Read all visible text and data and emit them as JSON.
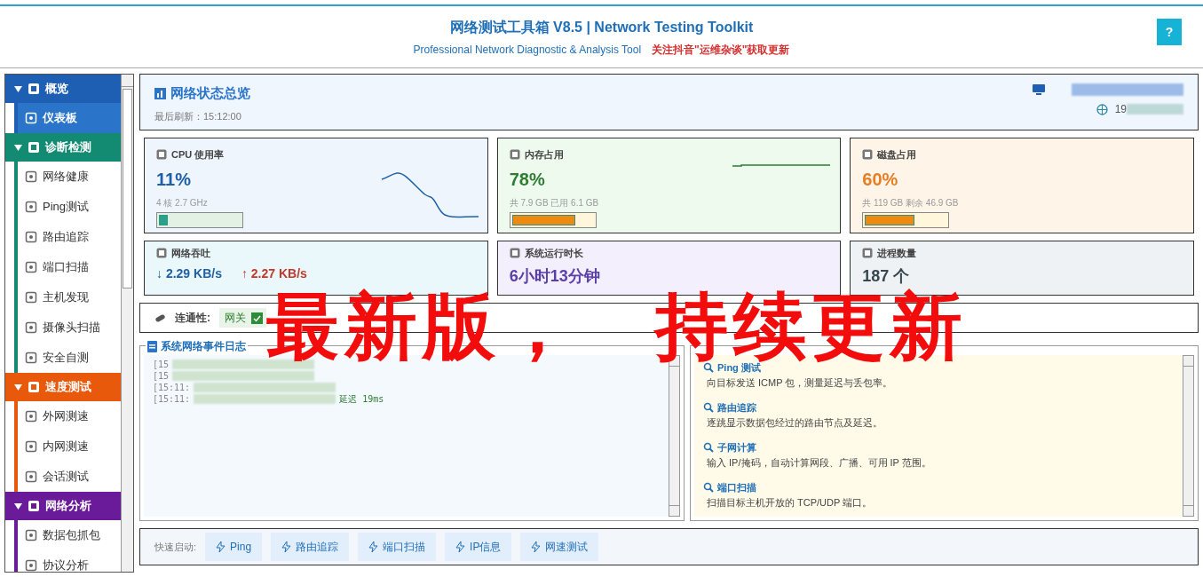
{
  "header": {
    "title": "网络测试工具箱 V8.5 | Network Testing Toolkit",
    "subtitle": "Professional Network Diagnostic & Analysis Tool",
    "promo": "关注抖音\"运维杂谈\"获取更新",
    "help_button": "?"
  },
  "sidebar": {
    "groups": [
      {
        "label": "概览",
        "color": "#1e5fb4",
        "expanded": true,
        "items": [
          {
            "label": "仪表板",
            "selected": true
          }
        ]
      },
      {
        "label": "诊断检测",
        "color": "#138a72",
        "expanded": true,
        "items": [
          {
            "label": "网络健康",
            "selected": false
          },
          {
            "label": "Ping测试",
            "selected": false
          },
          {
            "label": "路由追踪",
            "selected": false
          },
          {
            "label": "端口扫描",
            "selected": false
          },
          {
            "label": "主机发现",
            "selected": false
          },
          {
            "label": "摄像头扫描",
            "selected": false
          },
          {
            "label": "安全自测",
            "selected": false
          }
        ]
      },
      {
        "label": "速度测试",
        "color": "#e8590c",
        "expanded": true,
        "items": [
          {
            "label": "外网测速",
            "selected": false
          },
          {
            "label": "内网测速",
            "selected": false
          },
          {
            "label": "会话测试",
            "selected": false
          }
        ]
      },
      {
        "label": "网络分析",
        "color": "#6a1b9a",
        "expanded": true,
        "items": [
          {
            "label": "数据包抓包",
            "selected": false
          },
          {
            "label": "协议分析",
            "selected": false
          }
        ]
      }
    ]
  },
  "overview": {
    "title": "网络状态总览",
    "refreshed": "最后刷新：15:12:00",
    "ip_prefix": "19"
  },
  "cards": [
    {
      "kind": "meter",
      "title": "CPU 使用率",
      "value": "11%",
      "detail": "4 核  2.7 GHz",
      "level": 0.11,
      "color": "#1e5fa8"
    },
    {
      "kind": "meter",
      "title": "内存占用",
      "value": "78%",
      "detail": "共 7.9 GB  已用 6.1 GB",
      "level": 0.78,
      "color": "#2e7d32"
    },
    {
      "kind": "meter",
      "title": "磁盘占用",
      "value": "60%",
      "detail": "共 119 GB  剩余 46.9 GB",
      "level": 0.6,
      "color": "#e67e22"
    },
    {
      "kind": "throughput",
      "title": "网络吞吐",
      "down": "↓ 2.29 KB/s",
      "up": "↑ 2.27 KB/s",
      "color": "#1e5fa8"
    },
    {
      "kind": "plain",
      "title": "系统运行时长",
      "value": "6小时13分钟",
      "color": "#5b3fa8"
    },
    {
      "kind": "plain",
      "title": "进程数量",
      "value": "187 个",
      "color": "#37474f"
    }
  ],
  "connectivity": {
    "label": "连通性:",
    "checks": [
      {
        "label": "网关",
        "ok": true
      }
    ]
  },
  "event_log": {
    "title": "系统网络事件日志",
    "lines": [
      {
        "text": "[15"
      },
      {
        "text": "[15"
      },
      {
        "text": "[15:11:"
      },
      {
        "text": "[15:11:",
        "tail": "延迟 19ms"
      }
    ]
  },
  "tool_help": {
    "entries": [
      {
        "name": "Ping 测试",
        "desc": "向目标发送 ICMP 包，测量延迟与丢包率。"
      },
      {
        "name": "路由追踪",
        "desc": "逐跳显示数据包经过的路由节点及延迟。"
      },
      {
        "name": "子网计算",
        "desc": "输入 IP/掩码，自动计算网段、广播、可用 IP 范围。"
      },
      {
        "name": "端口扫描",
        "desc": "扫描目标主机开放的 TCP/UDP 端口。"
      }
    ]
  },
  "quick_launch": {
    "label": "快速启动:",
    "buttons": [
      "Ping",
      "路由追踪",
      "端口扫描",
      "IP信息",
      "网速测试"
    ]
  },
  "overlay_texts": [
    "最新版，",
    "持续更新"
  ]
}
